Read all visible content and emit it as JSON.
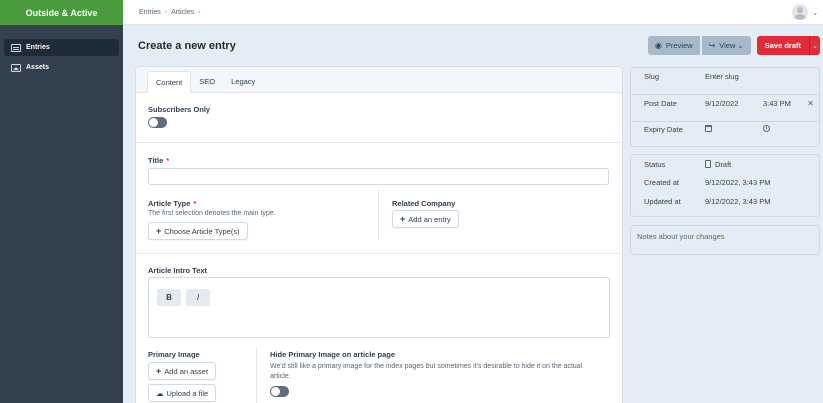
{
  "app": {
    "site_name": "Outside & Active"
  },
  "sidebar": {
    "items": [
      {
        "label": "Entries",
        "icon": "entries-icon",
        "active": true
      },
      {
        "label": "Assets",
        "icon": "assets-icon",
        "active": false
      }
    ]
  },
  "breadcrumbs": [
    "Entries",
    "Articles"
  ],
  "page": {
    "title": "Create a new entry"
  },
  "toolbar": {
    "preview_label": "Preview",
    "view_label": "View",
    "save_label": "Save draft"
  },
  "tabs": [
    "Content",
    "SEO",
    "Legacy"
  ],
  "fields": {
    "subscribers_only": {
      "label": "Subscribers Only",
      "on": false
    },
    "title": {
      "label": "Title",
      "required": "*",
      "value": ""
    },
    "article_type": {
      "label": "Article Type",
      "required": "*",
      "hint": "The first selection denotes the main type.",
      "button": "Choose Article Type(s)"
    },
    "related_company": {
      "label": "Related Company",
      "button": "Add an entry"
    },
    "intro_text": {
      "label": "Article Intro Text",
      "bold": "B",
      "italic": "I"
    },
    "primary_image": {
      "label": "Primary Image",
      "add_button": "Add an asset",
      "upload_button": "Upload a file"
    },
    "hide_primary_image": {
      "label": "Hide Primary Image on article page",
      "hint": "We'd still like a primary image for the index pages but sometimes it's desirable to hide it on the actual article.",
      "on": false
    }
  },
  "meta_panel": {
    "slug_label": "Slug",
    "slug_placeholder": "Enter slug",
    "post_date_label": "Post Date",
    "post_date": "9/12/2022",
    "post_time": "3:43 PM",
    "expiry_date_label": "Expiry Date"
  },
  "status_panel": {
    "status_label": "Status",
    "status_value": "Draft",
    "created_label": "Created at",
    "created_value": "9/12/2022, 3:43 PM",
    "updated_label": "Updated at",
    "updated_value": "9/12/2022, 3:43 PM"
  },
  "notes": {
    "placeholder": "Notes about your changes"
  },
  "colors": {
    "brand": "#4a9c3e",
    "sidebar": "#33404d",
    "accent_red": "#e12d39"
  }
}
